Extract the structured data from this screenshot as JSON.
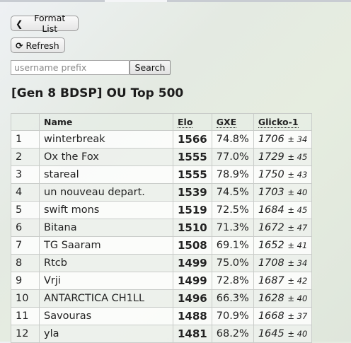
{
  "toolbar": {
    "format_list_label": "Format List",
    "refresh_label": "Refresh"
  },
  "search": {
    "placeholder": "username prefix",
    "value": "",
    "button_label": "Search"
  },
  "heading": "[Gen 8 BDSP] OU Top 500",
  "ladder": {
    "columns": [
      "",
      "Name",
      "Elo",
      "GXE",
      "Glicko-1"
    ],
    "rows": [
      {
        "rank": "1",
        "name": "winterbreak",
        "elo": "1566",
        "gxe": "74.8%",
        "glicko": "1706",
        "dev": "± 34"
      },
      {
        "rank": "2",
        "name": "Ox the Fox",
        "elo": "1555",
        "gxe": "77.0%",
        "glicko": "1729",
        "dev": "± 45"
      },
      {
        "rank": "3",
        "name": "stareal",
        "elo": "1555",
        "gxe": "78.9%",
        "glicko": "1750",
        "dev": "± 43"
      },
      {
        "rank": "4",
        "name": "un nouveau depart.",
        "elo": "1539",
        "gxe": "74.5%",
        "glicko": "1703",
        "dev": "± 40"
      },
      {
        "rank": "5",
        "name": "swift mons",
        "elo": "1519",
        "gxe": "72.5%",
        "glicko": "1684",
        "dev": "± 45"
      },
      {
        "rank": "6",
        "name": "Bitana",
        "elo": "1510",
        "gxe": "71.3%",
        "glicko": "1672",
        "dev": "± 47"
      },
      {
        "rank": "7",
        "name": "TG Saaram",
        "elo": "1508",
        "gxe": "69.1%",
        "glicko": "1652",
        "dev": "± 41"
      },
      {
        "rank": "8",
        "name": "Rtcb",
        "elo": "1499",
        "gxe": "75.0%",
        "glicko": "1708",
        "dev": "± 34"
      },
      {
        "rank": "9",
        "name": "Vrji",
        "elo": "1499",
        "gxe": "72.8%",
        "glicko": "1687",
        "dev": "± 42"
      },
      {
        "rank": "10",
        "name": "ANTARCTICA CH1LL",
        "elo": "1496",
        "gxe": "66.3%",
        "glicko": "1628",
        "dev": "± 40"
      },
      {
        "rank": "11",
        "name": "Savouras",
        "elo": "1488",
        "gxe": "70.9%",
        "glicko": "1668",
        "dev": "± 37"
      },
      {
        "rank": "12",
        "name": "yla",
        "elo": "1481",
        "gxe": "68.2%",
        "glicko": "1645",
        "dev": "± 40"
      }
    ]
  },
  "icons": {
    "format_list": "chevron-left-icon",
    "refresh": "refresh-icon"
  }
}
